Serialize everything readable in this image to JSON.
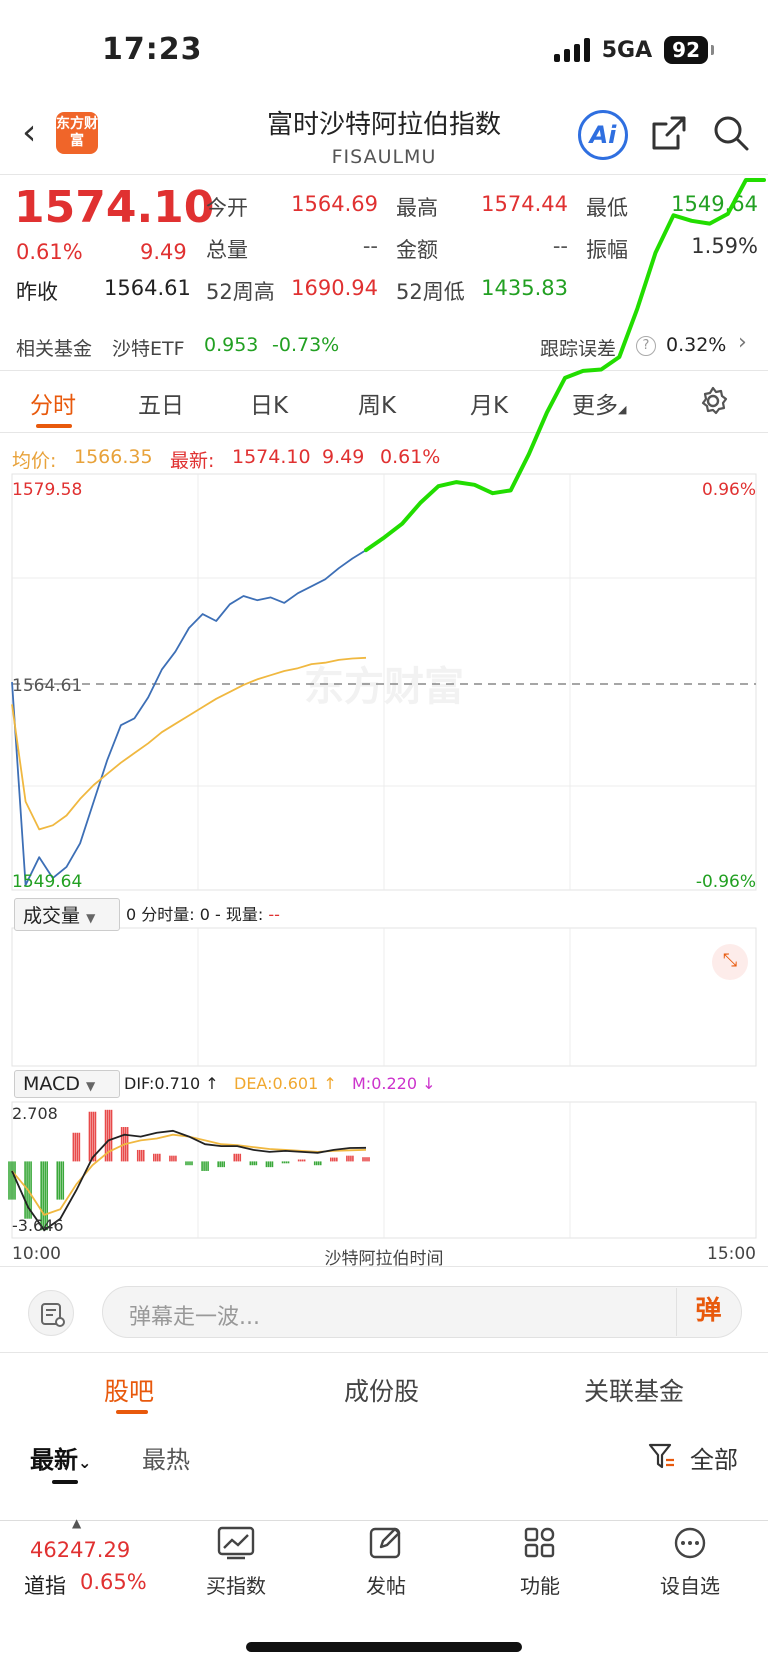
{
  "status_bar": {
    "time": "17:23",
    "network": "5GA",
    "battery": "92"
  },
  "header": {
    "title": "富时沙特阿拉伯指数",
    "subtitle": "FISAULMU",
    "logo_text": "东方财富",
    "ai_label": "Ai"
  },
  "quote": {
    "price": "1574.10",
    "change_pct": "0.61%",
    "change_val": "9.49",
    "prev_close_label": "昨收",
    "prev_close": "1564.61",
    "fields": [
      {
        "label": "今开",
        "value": "1564.69",
        "color": "red"
      },
      {
        "label": "最高",
        "value": "1574.44",
        "color": "red"
      },
      {
        "label": "最低",
        "value": "1549.64",
        "color": "green"
      },
      {
        "label": "总量",
        "value": "--",
        "color": "gray"
      },
      {
        "label": "金额",
        "value": "--",
        "color": "gray"
      },
      {
        "label": "振幅",
        "value": "1.59%",
        "color": "gray"
      },
      {
        "label": "52周高",
        "value": "1690.94",
        "color": "red"
      },
      {
        "label": "52周低",
        "value": "1435.83",
        "color": "green"
      }
    ]
  },
  "fund_row": {
    "label": "相关基金",
    "fund_name": "沙特ETF",
    "fund_price": "0.953",
    "fund_change": "-0.73%",
    "tracking_label": "跟踪误差",
    "tracking_value": "0.32%"
  },
  "tabs": [
    "分时",
    "五日",
    "日K",
    "周K",
    "月K",
    "更多"
  ],
  "info_line": {
    "avg_label": "均价:",
    "avg_value": "1566.35",
    "latest_label": "最新:",
    "latest_value": "1574.10",
    "latest_change": "9.49",
    "latest_pct": "0.61%"
  },
  "chart_labels": {
    "y_top": "1579.58",
    "y_mid": "1564.61",
    "y_bottom": "1549.64",
    "pct_top": "0.96%",
    "pct_bottom": "-0.96%",
    "time_start": "10:00",
    "time_mid": "沙特阿拉伯时间",
    "time_end": "15:00",
    "watermark": "东方财富"
  },
  "volume": {
    "selector": "成交量",
    "info": "0 分时量: 0 - 现量: ",
    "current": "--"
  },
  "macd": {
    "selector": "MACD",
    "dif": "DIF:0.710 ↑",
    "dea": "DEA:0.601 ↑",
    "m": "M:0.220 ↓",
    "top": "2.708",
    "bottom": "-3.646"
  },
  "comment_bar": {
    "placeholder": "弹幕走一波...",
    "danmu_label": "弹"
  },
  "bottom_tabs": [
    "股吧",
    "成份股",
    "关联基金"
  ],
  "sort": {
    "newest": "最新",
    "hottest": "最热",
    "filter_all": "全部"
  },
  "bottom_nav": {
    "dji_value": "46247.29",
    "dji_name": "道指",
    "dji_pct": "0.65%",
    "items": [
      {
        "label": "买指数"
      },
      {
        "label": "发帖"
      },
      {
        "label": "功能"
      },
      {
        "label": "设自选"
      }
    ]
  },
  "chart_data": {
    "type": "line",
    "title": "",
    "xlabel": "沙特阿拉伯时间",
    "ylabel": "",
    "x_range": [
      "10:00",
      "15:00"
    ],
    "ylim": [
      1549.64,
      1579.58
    ],
    "baseline": 1564.61,
    "grid": true,
    "series": [
      {
        "name": "最新",
        "color": "#3d6fb6",
        "values": [
          1564.6,
          1550.0,
          1552.0,
          1550.5,
          1551.3,
          1553.0,
          1556.0,
          1559.0,
          1561.5,
          1562.0,
          1563.5,
          1565.5,
          1566.8,
          1568.5,
          1569.5,
          1569.0,
          1570.2,
          1570.8,
          1570.5,
          1570.7,
          1570.3,
          1571.0,
          1571.5,
          1572.0,
          1572.8,
          1573.5,
          1574.1
        ]
      },
      {
        "name": "均价",
        "color": "#f0b840",
        "values": [
          1563.0,
          1556.0,
          1554.0,
          1554.3,
          1555.0,
          1556.2,
          1557.2,
          1558.0,
          1558.8,
          1559.5,
          1560.2,
          1561.0,
          1561.6,
          1562.2,
          1562.8,
          1563.4,
          1563.9,
          1564.4,
          1564.8,
          1565.1,
          1565.4,
          1565.6,
          1565.9,
          1566.0,
          1566.2,
          1566.3,
          1566.35
        ]
      }
    ],
    "annotation_line": {
      "color": "#22dd00",
      "values": [
        1574.1,
        1575.0,
        1576.0,
        1577.5,
        1578.7,
        1579.0,
        1578.8,
        1578.2,
        1578.4,
        1581.0,
        1584.0,
        1586.5,
        1587.0,
        1587.1,
        1588.0,
        1591.5,
        1595.5,
        1598.2,
        1597.8,
        1597.6,
        1598.3,
        1601.0,
        1605.0
      ]
    },
    "macd": {
      "dif": [
        -0.5,
        -2.4,
        -3.6,
        -3.0,
        -1.5,
        0.2,
        1.1,
        1.4,
        1.3,
        1.5,
        1.6,
        1.3,
        0.9,
        0.8,
        0.8,
        0.6,
        0.5,
        0.55,
        0.5,
        0.45,
        0.6,
        0.7,
        0.71
      ],
      "dea": [
        -0.5,
        -1.5,
        -2.8,
        -2.5,
        -1.2,
        -0.2,
        0.5,
        0.9,
        1.1,
        1.2,
        1.4,
        1.3,
        1.1,
        0.9,
        0.85,
        0.75,
        0.65,
        0.6,
        0.55,
        0.5,
        0.55,
        0.58,
        0.6
      ],
      "hist": [
        -2.0,
        -3.0,
        -3.6,
        -2.0,
        1.5,
        2.6,
        2.7,
        1.8,
        0.6,
        0.4,
        0.3,
        -0.2,
        -0.5,
        -0.3,
        0.4,
        -0.2,
        -0.3,
        -0.1,
        0.1,
        -0.2,
        0.2,
        0.3,
        0.22
      ]
    }
  }
}
